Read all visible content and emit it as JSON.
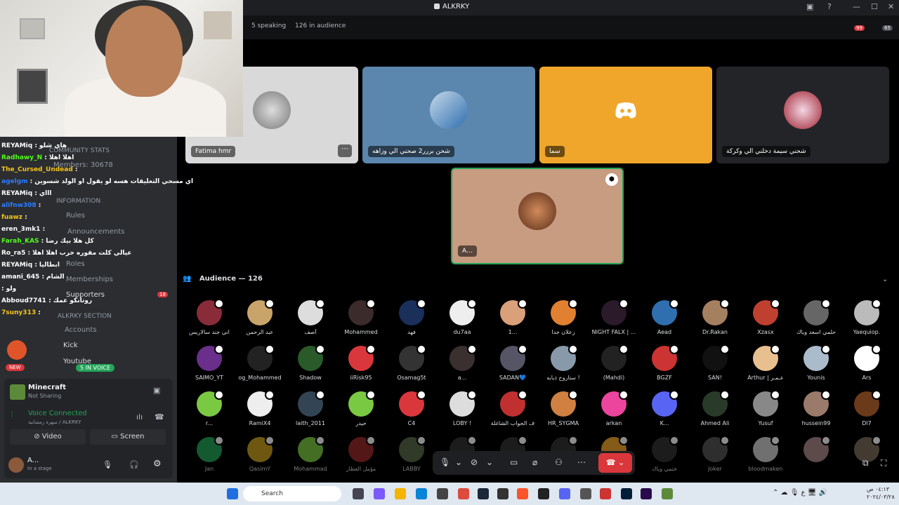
{
  "window": {
    "title": "ALKRKY"
  },
  "stage": {
    "speaking": "5 speaking",
    "audience_count": "126 in audience",
    "inbox_badge": "99",
    "audience_badge": "65"
  },
  "speakers": [
    {
      "name": "Fatima hmr",
      "bg": "#d9d9d9"
    },
    {
      "name": "شحن بررر2 صحني الي وزاهه",
      "bg": "#5b86ad"
    },
    {
      "name": "سما",
      "bg": "#f0a62a"
    },
    {
      "name": "شحني سيمة دخلني الي وكركة",
      "bg": "#232428"
    },
    {
      "name": "A...",
      "bg": "#c79c80"
    }
  ],
  "audience": {
    "header": "Audience — 126",
    "members": [
      "اني جند سالاريس",
      "عبد الرحمن",
      "آصف",
      "Mohammed",
      "فهد",
      "du7aa",
      "1...",
      "زعلان جدا",
      "NIGHT FALX | ...",
      "Aead",
      "Dr.Rakan",
      "Xzasx",
      "حلمي اسعد وياك",
      "Yaequiop.",
      "SAIMO_YT",
      "og_Mohammed",
      "Shadow",
      "iiRisk95",
      "Osamag5t",
      "a...",
      "SADAN💙",
      "ستاروخ ذبابه !",
      "(Mahdi)",
      "BGZF",
      "SAN!",
      "Arthur | عـمـر",
      "Younis",
      "Ars",
      "r...",
      "RamiX4",
      "laith_2011",
      "حيدر",
      "C4",
      "LOBY !",
      "ف الجواب الشاغلة",
      "HR_SYGMA",
      "arkan",
      "K...",
      "Ahmed Ali",
      "Yusuf",
      "hussein99",
      "Dl7",
      "Jan",
      "QasimY",
      "Mohammad",
      "مؤمل العطار",
      "LABBY",
      "",
      "",
      "",
      "",
      "ختمي وياك",
      "Joker",
      "bloodmaken",
      "",
      ""
    ]
  },
  "chat": [
    {
      "user": "REYAMiq",
      "msg": "هاي شلو",
      "color": "#ffffff"
    },
    {
      "user": "Radhawy_N",
      "msg": "اهلا اهلا",
      "color": "#53fc18"
    },
    {
      "user": "The_Cursed_Undead",
      "msg": "",
      "color": "#f5c518"
    },
    {
      "user": "agelgm",
      "msg": "اي مسحي التعليقات هسه لو يقول او الولد شسوين",
      "color": "#2d7dff"
    },
    {
      "user": "REYAMiq",
      "msg": "اااي",
      "color": "#ffffff"
    },
    {
      "user": "alifnw308",
      "msg": "",
      "color": "#2d7dff"
    },
    {
      "user": "fuawz",
      "msg": "",
      "color": "#f5c518"
    },
    {
      "user": "eren_3mk1",
      "msg": "",
      "color": "#ffffff"
    },
    {
      "user": "Farah_KAS",
      "msg": "كل هلا بيك رضا",
      "color": "#53fc18"
    },
    {
      "user": "Ro_ra5",
      "msg": "عيالي كلت مقوره خرب اهلا اهلا",
      "color": "#ffffff"
    },
    {
      "user": "REYAMiq",
      "msg": "ابطاليا",
      "color": "#ffffff"
    },
    {
      "user": "amani_645",
      "msg": "الشام",
      "color": "#ffffff"
    },
    {
      "user": "",
      "msg": "ولو",
      "color": "#ffffff"
    },
    {
      "user": "Abboud7741",
      "msg": "روتانكو عمك",
      "color": "#ffffff"
    },
    {
      "user": "7suny313",
      "msg": "",
      "color": "#f5c518"
    }
  ],
  "sidebar": {
    "community_stats": "COMMUNITY STATS",
    "members": "Members: 30678",
    "information": "INFORMATION",
    "rules": "Rules",
    "announcements": "Announcements",
    "roles": "Roles",
    "memberships": "Memberships",
    "supporters": "Supporters",
    "supporters_badge": "18",
    "section": "ALKRKY SECTION",
    "accounts": "Accounts",
    "kick": "Kick",
    "youtube": "Youtube",
    "in_voice": "5 IN VOICE",
    "new_badge": "NEW"
  },
  "panel": {
    "game": "Minecraft",
    "game_status": "Not Sharing",
    "voice": "Voice Connected",
    "voice_channel": "سهرة رمضانية / ALKRKY",
    "video": "Video",
    "screen": "Screen",
    "user": "A...",
    "user_status": "In a stage"
  },
  "taskbar": {
    "search": "Search"
  }
}
